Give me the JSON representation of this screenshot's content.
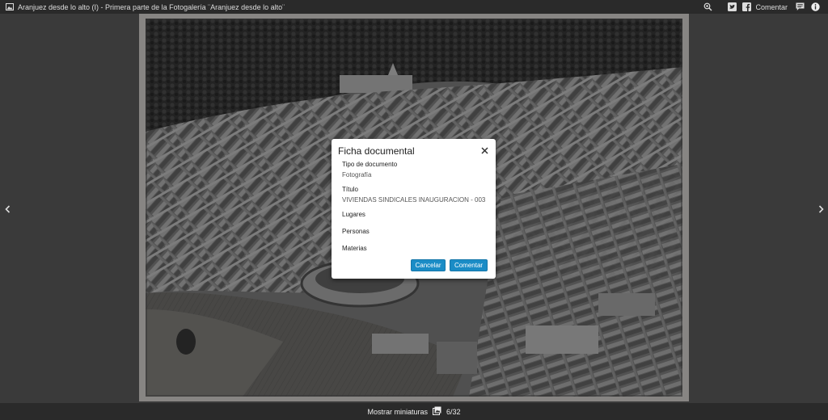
{
  "header": {
    "title": "Aranjuez desde lo alto (I) - Primera parte de la Fotogalería ¨Aranjuez desde lo alto¨",
    "comment_label": "Comentar"
  },
  "dialog": {
    "title": "Ficha documental",
    "fields": [
      {
        "label": "Tipo de documento",
        "value": "Fotografía"
      },
      {
        "label": "Título",
        "value": "VIVIENDAS SINDICALES INAUGURACION - 003"
      },
      {
        "label": "Lugares",
        "value": ""
      },
      {
        "label": "Personas",
        "value": ""
      },
      {
        "label": "Materias",
        "value": ""
      }
    ],
    "cancel_label": "Cancelar",
    "submit_label": "Comentar"
  },
  "footer": {
    "thumbnails_label": "Mostrar miniaturas",
    "counter": "6/32"
  },
  "colors": {
    "accent": "#1a8cc6",
    "bar_bg": "#2a2a2a",
    "stage_bg": "#3a3a3a"
  },
  "icons": [
    "image-icon",
    "zoom-icon",
    "twitter-icon",
    "facebook-icon",
    "comment-icon",
    "info-icon",
    "chevron-left-icon",
    "chevron-right-icon",
    "close-icon",
    "thumbnails-icon"
  ]
}
